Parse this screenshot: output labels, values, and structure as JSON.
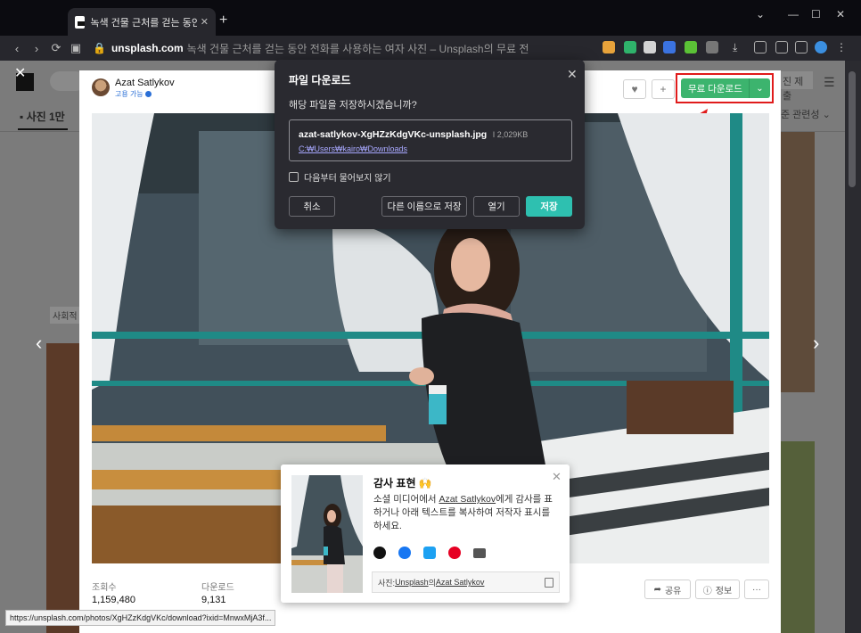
{
  "browser": {
    "tab_title": "녹색 건물 근처를 걷는 동안 전화",
    "url_host": "unsplash.com",
    "url_rest": "녹색 건물 근처를 걷는 동안 전화를 사용하는 여자 사진 – Unsplash의 무료 전",
    "status_url": "https://unsplash.com/photos/XgHZzKdgVKc/download?ixid=MnwxMjA3f..."
  },
  "background_page": {
    "tab_label": "사진 1만",
    "tag_label": "사회적",
    "submit_label": "진 제출",
    "sort_label": "준 관련성"
  },
  "modal": {
    "author_name": "Azat Satlykov",
    "author_sub": "고용 가능",
    "download_label": "무료 다운로드",
    "stats": [
      {
        "label": "조회수",
        "value": "1,159,480"
      },
      {
        "label": "다운로드",
        "value": "9,131"
      }
    ],
    "share_label": "공유",
    "info_label": "정보",
    "more_label": "···"
  },
  "thanks_popup": {
    "title": "감사 표현 🙌",
    "body_pre": "소셜 미디어에서 ",
    "body_link": "Azat Satlykov",
    "body_post": "에게 감사를 표하거나 아래 텍스트를 복사하여 저작자 표시를 하세요.",
    "credit_prefix": "사진: ",
    "credit_source": "Unsplash",
    "credit_mid": "의",
    "credit_author": "Azat Satlykov"
  },
  "download_dialog": {
    "title": "파일 다운로드",
    "question": "해당 파일을 저장하시겠습니까?",
    "file_name": "azat-satlykov-XgHZzKdgVKc-unsplash.jpg",
    "file_size": "2,029KB",
    "file_path": "C:₩Users₩kairo₩Downloads",
    "checkbox_label": "다음부터 물어보지 않기",
    "cancel_label": "취소",
    "save_as_label": "다른 이름으로 저장",
    "open_label": "열기",
    "save_label": "저장"
  },
  "colors": {
    "download_green": "#3cb46e",
    "dialog_accent": "#2ec0b0",
    "highlight_red": "#e01b1b"
  }
}
